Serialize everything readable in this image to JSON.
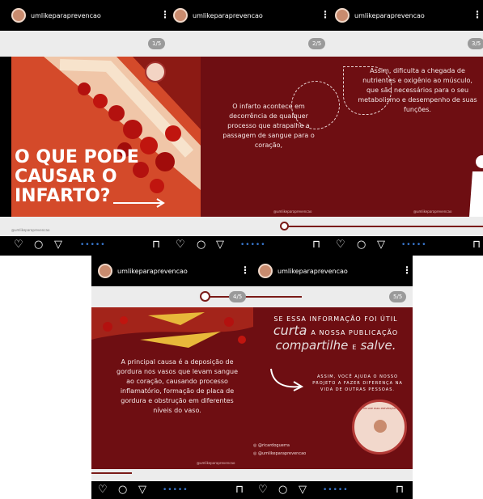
{
  "account": "umlikeparaprevencao",
  "counters": [
    "1/5",
    "2/5",
    "3/5",
    "4/5",
    "5/5"
  ],
  "slide1": {
    "title_lines": [
      "O QUE PODE",
      "CAUSAR O",
      "INFARTO?"
    ],
    "credit": "@umlikeparaprevencao"
  },
  "slide2": {
    "text": "O infarto acontece em decorrência de qualquer processo que atrapalhe a passagem de sangue para o coração,",
    "credit": "@umlikeparaprevencao"
  },
  "slide3": {
    "text": "Assim, dificulta a chegada de nutrientes e oxigênio ao músculo, que são necessários para o seu metabolismo e desempenho de suas funções.",
    "credit": "@umlikeparaprevencao"
  },
  "slide4": {
    "text": "A principal causa é a deposição de gordura nos vasos que levam sangue ao coração, causando processo inflamatório, formação de placa de gordura e obstrução em diferentes níveis do vaso.",
    "credit": "@umlikeparaprevencao"
  },
  "slide5": {
    "line1": "SE ESSA INFORMAÇÃO FOI ÚTIL",
    "curta": "curta",
    "line2": "A NOSSA PUBLICAÇÃO",
    "compartilhe": "compartilhe",
    "e": "E",
    "salve": "salve.",
    "small": "ASSIM, VOCÊ AJUDA O NOSSO PROJETO A FAZER DIFERENÇA NA VIDA DE OUTRAS PESSOAS.",
    "handle1": "@ricardoguerra",
    "handle2": "@umlikeparaprevencao",
    "credit": "@umlikeparaprevencao",
    "logo_text": "UM LIKE PARA PREVENÇÃO"
  },
  "icons": [
    "heart-icon",
    "comment-icon",
    "share-icon",
    "bookmark-icon",
    "more-icon",
    "arrow-icon"
  ],
  "colors": {
    "slide_bg": "#6e0e12",
    "accent": "#3a7bd5"
  }
}
